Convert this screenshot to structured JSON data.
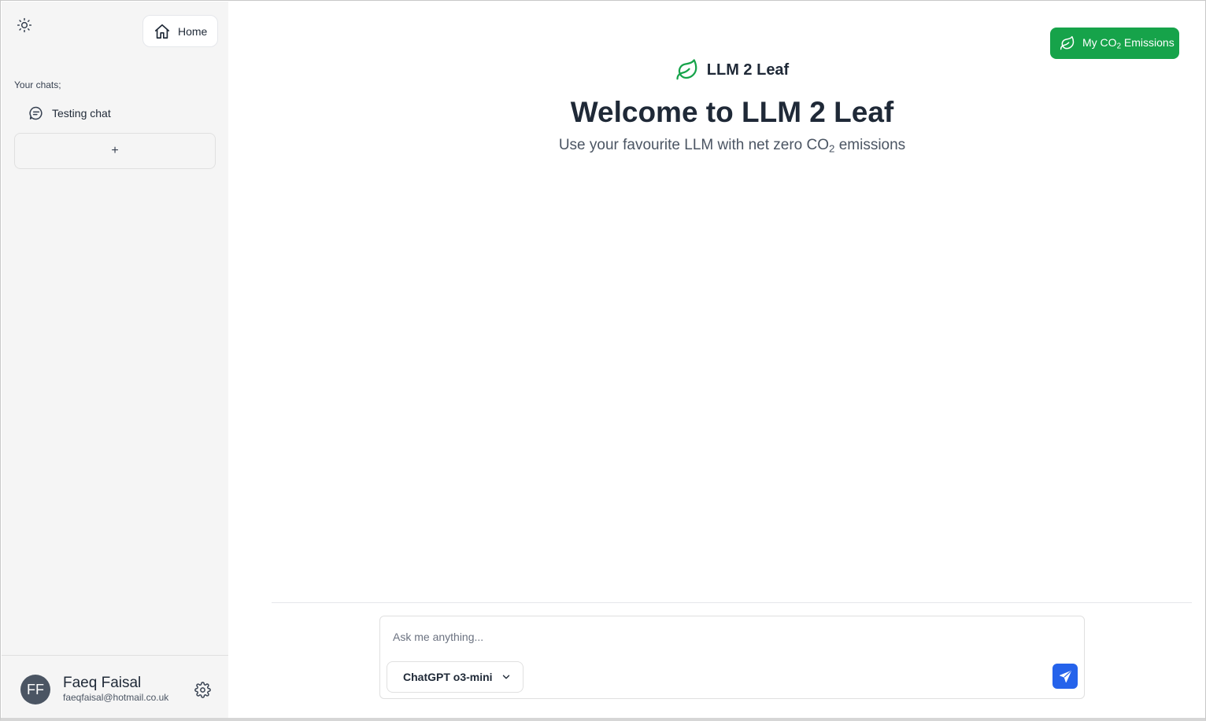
{
  "sidebar": {
    "home_label": "Home",
    "chats_label": "Your chats;",
    "chats": [
      {
        "title": "Testing chat"
      }
    ],
    "new_chat_label": "+",
    "user": {
      "initials": "FF",
      "name": "Faeq Faisal",
      "email": "faeqfaisal@hotmail.co.uk"
    }
  },
  "header": {
    "co2_button_prefix": "My CO",
    "co2_button_sub": "2",
    "co2_button_suffix": " Emissions"
  },
  "hero": {
    "brand": "LLM 2 Leaf",
    "title": "Welcome to LLM 2 Leaf",
    "subtitle_prefix": "Use your favourite LLM with net zero CO",
    "subtitle_sub": "2",
    "subtitle_suffix": " emissions"
  },
  "composer": {
    "placeholder": "Ask me anything...",
    "model": "ChatGPT o3-mini"
  },
  "colors": {
    "brand_green": "#16a34a",
    "send_blue": "#2563eb",
    "sidebar_bg": "#f5f5f5",
    "avatar_bg": "#4b5563"
  },
  "icons": {
    "theme": "sun-icon",
    "home": "home-icon",
    "chat": "chat-bubble-icon",
    "leaf": "leaf-icon",
    "settings": "gear-icon",
    "dropdown": "chevron-down-icon",
    "send": "send-icon"
  }
}
